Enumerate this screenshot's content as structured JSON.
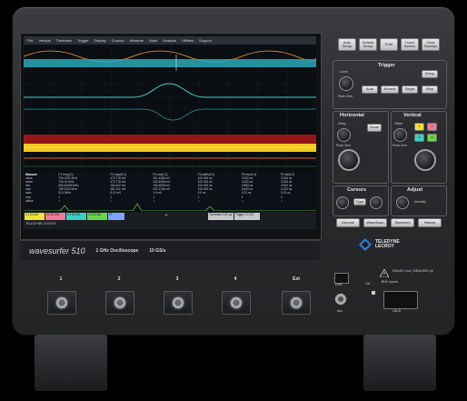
{
  "menu": [
    "File",
    "Vertical",
    "Timebase",
    "Trigger",
    "Display",
    "Cursors",
    "Measure",
    "Math",
    "Analysis",
    "Utilities",
    "Support"
  ],
  "measurements": {
    "header": [
      "Measure",
      "P1 freq(C1)",
      "P2 ampl(C1)",
      "P3 rms(C2)",
      "P4 width(C3)",
      "P5 rise(C4)",
      "P6 fall(C3)"
    ],
    "rows": [
      [
        "value",
        "730.0431 MHz",
        "472.778 mV",
        "201.4366 mV",
        "100.000 ns",
        "4.932 ns",
        "3.294 ns"
      ],
      [
        "mean",
        "730.04 MHz",
        "472.778 mV",
        "200.4565 mV",
        "100.000 ns",
        "4.932 ns",
        "3.294 ns"
      ],
      [
        "min",
        "555.61039 MHz",
        "182.402 mV",
        "190.4826 mV",
        "100.000 ns",
        "3.850 ns",
        "2.510 ns"
      ],
      [
        "max",
        "769.9103 MHz",
        "481.201 mV",
        "202.1135 mV",
        "100.000 ns",
        "5.620 ns",
        "4.012 ns"
      ],
      [
        "sdev",
        "52.4 MHz",
        "6.12 mV",
        "1.5 mV",
        "0.0 ns",
        "0.31 ns",
        "0.22 ns"
      ],
      [
        "num",
        "1",
        "1",
        "1",
        "1",
        "1",
        "1"
      ],
      [
        "status",
        "✓",
        "✓",
        "✓",
        "✓",
        "✓",
        "✓"
      ]
    ]
  },
  "descriptors": [
    {
      "label": "C1 DC1M",
      "color": "#f2e33a"
    },
    {
      "label": "C2 DC1M",
      "color": "#f07a9a"
    },
    {
      "label": "C3 DC1M",
      "color": "#3ad0c4"
    },
    {
      "label": "C4 DC1M",
      "color": "#68d64a"
    },
    {
      "label": "F1",
      "color": "#7fa3ff"
    },
    {
      "label": "+",
      "color": "#d8d8d8"
    },
    {
      "label": "Timebase 0.00 µs",
      "color": "#c8c8c8"
    },
    {
      "label": "Trigger C1 DC",
      "color": "#c8c8c8"
    }
  ],
  "statusline": "TELEDYNE LECROY",
  "namebar": {
    "brand": "wavesurfer 510",
    "bandwidth": "1 GHz Oscilloscope",
    "rate": "10 GS/s"
  },
  "panel": {
    "top_buttons": [
      "Auto Setup",
      "Default Setup",
      "Print",
      "Touch Screen",
      "Clear Sweeps"
    ],
    "trigger": {
      "title": "Trigger",
      "level": "Level",
      "setup": "Setup",
      "auto": "Auto",
      "normal": "Normal",
      "single": "Single",
      "stop": "Stop",
      "push_zero": "Push Zero"
    },
    "horizontal": {
      "title": "Horizontal",
      "delay": "Delay",
      "push_zero": "Push Zero",
      "zoom": "Zoom"
    },
    "vertical": {
      "title": "Vertical",
      "offset": "Offset",
      "push_zero": "Push Zero",
      "ch_buttons": [
        "1",
        "2",
        "3",
        "4"
      ]
    },
    "cursors": {
      "title": "Cursors",
      "type": "Type"
    },
    "adjust": {
      "title": "Adjust",
      "intensity": "Intensity"
    },
    "bottom_buttons": [
      "Decode",
      "WaveScan",
      "Spectrum",
      "History"
    ],
    "logo": [
      "TELEDYNE",
      "LECROY"
    ]
  },
  "inputs": {
    "channels": [
      "1",
      "2",
      "3",
      "4",
      "Ext"
    ],
    "aux": "Aux",
    "cal": "Cal",
    "lbus": "LBUS",
    "bnc_note": "50Ω≤5V rms | 1MΩ≤400V pk",
    "bnc_inputs": "BNC Inputs",
    "usb": "USB"
  },
  "colors": {
    "ch1": "#f2e33a",
    "ch2": "#f07a9a",
    "ch3": "#3ad0c4",
    "ch4": "#68d64a",
    "chassis": "#2a2b2e"
  }
}
